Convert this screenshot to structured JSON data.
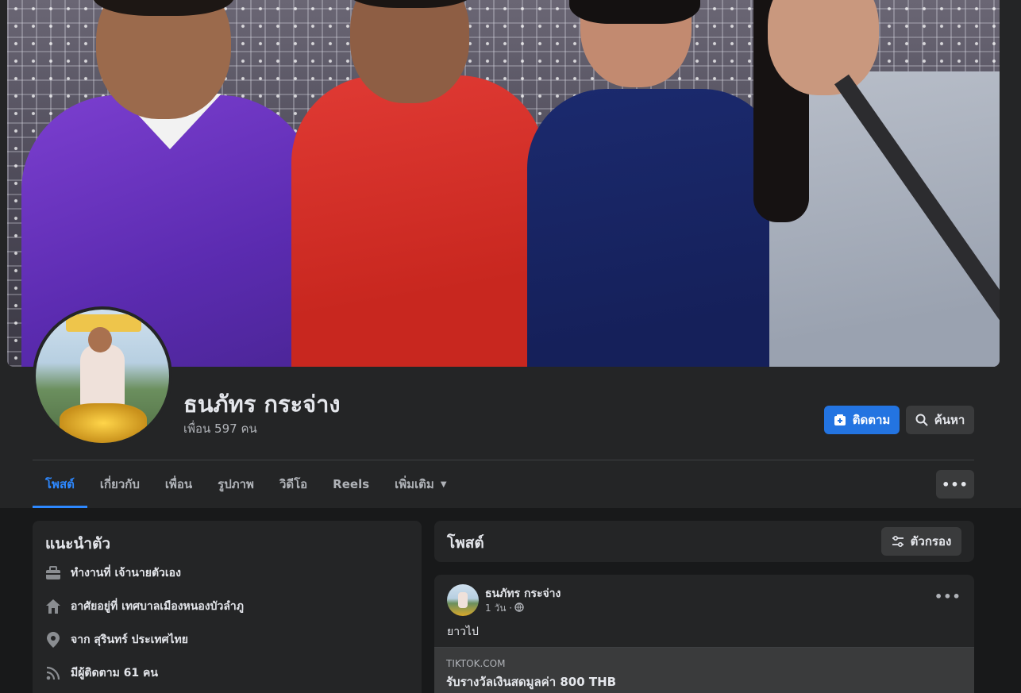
{
  "profile": {
    "name": "ธนภัทร กระจ่าง",
    "friends": "เพื่อน 597 คน",
    "follow_label": "ติดตาม",
    "search_label": "ค้นหา"
  },
  "tabs": [
    {
      "label": "โพสต์",
      "active": true
    },
    {
      "label": "เกี่ยวกับ"
    },
    {
      "label": "เพื่อน"
    },
    {
      "label": "รูปภาพ"
    },
    {
      "label": "วิดีโอ"
    },
    {
      "label": "Reels"
    },
    {
      "label": "เพิ่มเติม"
    }
  ],
  "more_label": "•••",
  "intro": {
    "title": "แนะนำตัว",
    "items": [
      {
        "icon": "briefcase-icon",
        "text": "ทำงานที่ เจ้านายตัวเอง"
      },
      {
        "icon": "home-icon",
        "text": "อาศัยอยู่ที่ เทศบาลเมืองหนองบัวลำภู"
      },
      {
        "icon": "location-pin-icon",
        "text": "จาก สุรินทร์ ประเทศไทย"
      },
      {
        "icon": "rss-icon",
        "text": "มีผู้ติดตาม 61 คน"
      }
    ]
  },
  "posts": {
    "title": "โพสต์",
    "filter_label": "ตัวกรอง"
  },
  "post": {
    "author": "ธนภัทร กระจ่าง",
    "time": "1 วัน ·",
    "text": "ยาวไป",
    "link_domain": "TIKTOK.COM",
    "link_title": "รับรางวัลเงินสดมูลค่า 800 THB"
  },
  "colors": {
    "accent": "#2374e1",
    "background": "#18191a",
    "card": "#242526",
    "button": "#3a3b3c"
  }
}
